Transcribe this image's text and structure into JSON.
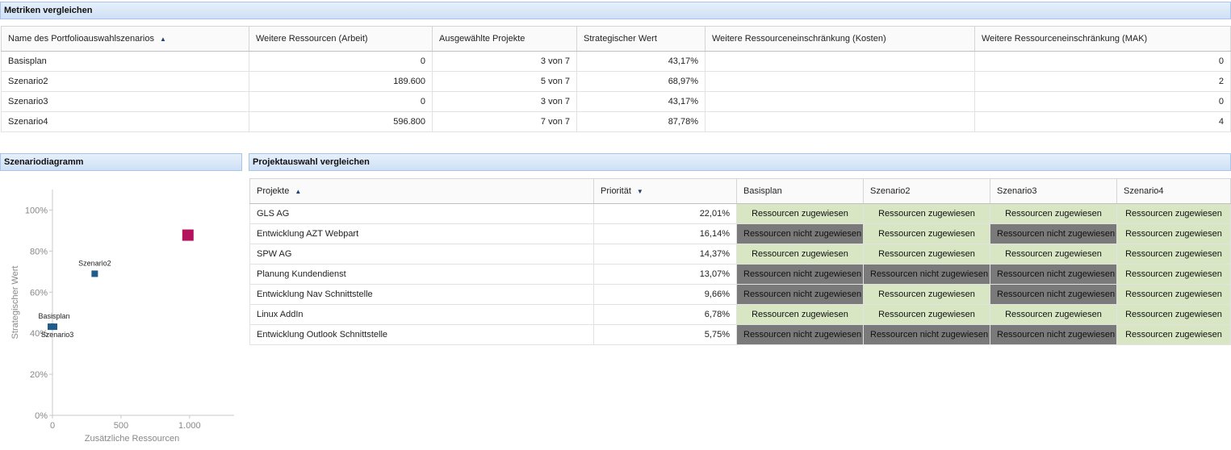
{
  "metrics": {
    "title": "Metriken vergleichen",
    "columns": [
      "Name des Portfolioauswahlszenarios",
      "Weitere Ressourcen (Arbeit)",
      "Ausgewählte Projekte",
      "Strategischer Wert",
      "Weitere Ressourceneinschränkung (Kosten)",
      "Weitere Ressourceneinschränkung (MAK)"
    ],
    "rows": [
      {
        "name": "Basisplan",
        "arbeit": "0",
        "projekte": "3 von 7",
        "wert": "43,17%",
        "kosten": "",
        "mak": "0"
      },
      {
        "name": "Szenario2",
        "arbeit": "189.600",
        "projekte": "5 von 7",
        "wert": "68,97%",
        "kosten": "",
        "mak": "2"
      },
      {
        "name": "Szenario3",
        "arbeit": "0",
        "projekte": "3 von 7",
        "wert": "43,17%",
        "kosten": "",
        "mak": "0"
      },
      {
        "name": "Szenario4",
        "arbeit": "596.800",
        "projekte": "7 von 7",
        "wert": "87,78%",
        "kosten": "",
        "mak": "4"
      }
    ]
  },
  "diagram": {
    "title": "Szenariodiagramm"
  },
  "selection": {
    "title": "Projektauswahl vergleichen",
    "columns": [
      "Projekte",
      "Priorität",
      "Basisplan",
      "Szenario2",
      "Szenario3",
      "Szenario4"
    ],
    "assigned_label": "Ressourcen zugewiesen",
    "not_assigned_label": "Ressourcen nicht zugewiesen",
    "colors": {
      "assigned": "#d8e6c3",
      "not_assigned": "#7a7a7a"
    },
    "rows": [
      {
        "project": "GLS AG",
        "priority": "22,01%",
        "status": [
          true,
          true,
          true,
          true
        ]
      },
      {
        "project": "Entwicklung AZT Webpart",
        "priority": "16,14%",
        "status": [
          false,
          true,
          false,
          true
        ]
      },
      {
        "project": "SPW AG",
        "priority": "14,37%",
        "status": [
          true,
          true,
          true,
          true
        ]
      },
      {
        "project": "Planung Kundendienst",
        "priority": "13,07%",
        "status": [
          false,
          false,
          false,
          true
        ]
      },
      {
        "project": "Entwicklung Nav Schnittstelle",
        "priority": "9,66%",
        "status": [
          false,
          true,
          false,
          true
        ]
      },
      {
        "project": "Linux AddIn",
        "priority": "6,78%",
        "status": [
          true,
          true,
          true,
          true
        ]
      },
      {
        "project": "Entwicklung Outlook Schnittstelle",
        "priority": "5,75%",
        "status": [
          false,
          false,
          false,
          true
        ]
      }
    ]
  },
  "chart_data": {
    "type": "scatter",
    "xlabel": "Zusätzliche Ressourcen",
    "ylabel": "Strategischer Wert",
    "xlim": [
      0,
      1325
    ],
    "ylim": [
      0,
      1.1
    ],
    "xticks": [
      0,
      500,
      1000
    ],
    "xtick_labels": [
      "0",
      "500",
      "1.000"
    ],
    "yticks": [
      0,
      0.2,
      0.4,
      0.6,
      0.8,
      1.0
    ],
    "ytick_labels": [
      "0%",
      "20%",
      "40%",
      "60%",
      "80%",
      "100%"
    ],
    "grid": false,
    "points": [
      {
        "label": "Basisplan",
        "x": 0,
        "y": 0.4317,
        "color": "#1f5c8c",
        "highlight": false
      },
      {
        "label": "Szenario2",
        "x": 320,
        "y": 0.6897,
        "color": "#1f5c8c",
        "highlight": false
      },
      {
        "label": "Szenario3",
        "x": 0,
        "y": 0.4317,
        "color": "#1f5c8c",
        "highlight": false
      },
      {
        "label": "",
        "x": 1000,
        "y": 0.8778,
        "color": "#b5125e",
        "highlight": true
      }
    ]
  }
}
